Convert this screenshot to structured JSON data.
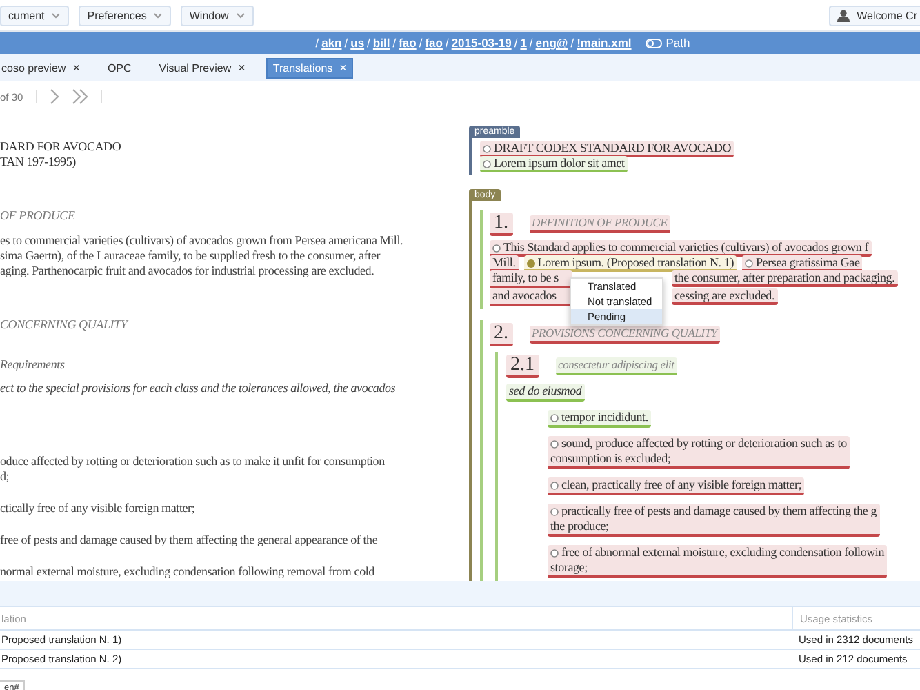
{
  "menubar": {
    "menus": [
      {
        "label": "cument"
      },
      {
        "label": "Preferences"
      },
      {
        "label": "Window"
      }
    ],
    "user": "Welcome Cr"
  },
  "path_bar": {
    "separator": "/",
    "segments": [
      "akn",
      "us",
      "bill",
      "fao",
      "fao",
      "2015-03-19",
      "1",
      "eng@",
      "!main.xml"
    ],
    "toggle": "Path"
  },
  "tabs": [
    {
      "label": "coso preview",
      "selected": false,
      "close": "×"
    },
    {
      "label": "OPC",
      "selected": false
    },
    {
      "label": "Visual Preview",
      "selected": false,
      "close": "×"
    },
    {
      "label": "Translations",
      "selected": true,
      "close": "×"
    }
  ],
  "pager": {
    "text": "of 30"
  },
  "source_document": [
    {
      "kind": "title",
      "lines": [
        "DARD FOR AVOCADO",
        "TAN 197-1995)"
      ]
    },
    {
      "kind": "heading",
      "lines": [
        "OF PRODUCE"
      ]
    },
    {
      "kind": "paragraph",
      "lines": [
        "es to commercial varieties (cultivars) of avocados grown from Persea americana Mill.",
        "sima Gaertn), of the Lauraceae family, to be supplied fresh to the consumer, after",
        "aging. Parthenocarpic fruit and avocados for industrial processing are excluded."
      ]
    },
    {
      "kind": "heading",
      "lines": [
        "CONCERNING QUALITY"
      ]
    },
    {
      "kind": "subheading",
      "lines": [
        "Requirements"
      ]
    },
    {
      "kind": "intro",
      "lines": [
        "ect to the special provisions for each class and the tolerances allowed, the avocados"
      ]
    },
    {
      "kind": "item",
      "lines": [
        "oduce affected by rotting or deterioration such as to make it unfit for consumption",
        "d;"
      ]
    },
    {
      "kind": "item",
      "lines": [
        "ctically free of any visible foreign matter;"
      ]
    },
    {
      "kind": "item",
      "lines": [
        "free of pests and damage caused by them affecting the general appearance of the"
      ]
    },
    {
      "kind": "item",
      "lines": [
        "normal external moisture, excluding condensation following removal from cold"
      ]
    }
  ],
  "markup_view": {
    "preamble": {
      "label": "preamble",
      "color": "#5a6f8e",
      "units": [
        {
          "kind": "untranslated",
          "lines": [
            "DRAFT CODEX STANDARD FOR AVOCADO"
          ]
        },
        {
          "kind": "translated",
          "lines": [
            "Lorem ipsum dolor sit amet"
          ]
        }
      ]
    },
    "body": {
      "label": "body",
      "color": "#8c8452",
      "sections": [
        {
          "num": {
            "text": "1.",
            "kind": "untranslated"
          },
          "heading": {
            "text": "DEFINITION OF PRODUCE",
            "kind": "untranslated"
          },
          "paragraph": [
            [
              {
                "text": "This Standard applies to commercial varieties (cultivars) of avocados grown f",
                "kind": "untranslated",
                "marked": true
              }
            ],
            [
              {
                "text": "Mill.",
                "kind": "untranslated",
                "marked": false
              },
              {
                "text": "Lorem ipsum. (Proposed translation N. 1)",
                "kind": "pending",
                "marked": true
              },
              {
                "text": "Persea gratissima Gae",
                "kind": "untranslated",
                "marked": true
              }
            ],
            [
              {
                "text": "family, to be s",
                "kind": "untranslated",
                "marked": false
              },
              {
                "text": "the consumer, after preparation and packaging.",
                "kind": "untranslated",
                "marked": false,
                "hidden_before": true
              }
            ],
            [
              {
                "text": "and avocados",
                "kind": "untranslated",
                "marked": false
              },
              {
                "text": "cessing are excluded.",
                "kind": "untranslated",
                "marked": false,
                "hidden_before": true
              }
            ]
          ]
        },
        {
          "num": {
            "text": "2.",
            "kind": "untranslated"
          },
          "heading": {
            "text": "PROVISIONS CONCERNING QUALITY",
            "kind": "untranslated"
          },
          "subsections": [
            {
              "num": {
                "text": "2.1",
                "kind": "untranslated"
              },
              "heading": {
                "text": "consectetur adipiscing elit",
                "kind": "translated"
              },
              "subheading": {
                "text": "sed do eiusmod",
                "kind": "translated"
              },
              "units": [
                {
                  "kind": "translated",
                  "lines": [
                    "tempor incididunt."
                  ]
                },
                {
                  "kind": "untranslated",
                  "lines": [
                    "sound, produce affected by rotting or deterioration such as to",
                    "consumption is excluded;"
                  ]
                },
                {
                  "kind": "untranslated",
                  "lines": [
                    "clean, practically free of any visible foreign matter;"
                  ]
                },
                {
                  "kind": "untranslated",
                  "lines": [
                    "practically free of pests and damage caused by them affecting the g",
                    "the produce;"
                  ]
                },
                {
                  "kind": "untranslated",
                  "lines": [
                    "free of abnormal external moisture, excluding condensation followin",
                    "storage;"
                  ]
                }
              ]
            }
          ]
        }
      ]
    },
    "context_menu": {
      "items": [
        {
          "label": "Translated",
          "selected": false
        },
        {
          "label": "Not translated",
          "selected": false
        },
        {
          "label": "Pending",
          "selected": true
        }
      ]
    }
  },
  "translations_table": {
    "columns": [
      "lation",
      "Usage statistics"
    ],
    "rows": [
      [
        "Proposed translation N. 1)",
        "Used in 2312 documents"
      ],
      [
        "Proposed translation N. 2)",
        "Used in 212 documents"
      ]
    ]
  },
  "footer": {
    "tab": "en#"
  }
}
